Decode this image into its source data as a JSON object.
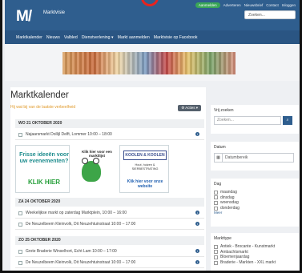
{
  "header": {
    "logo_text": "M/",
    "site_name": "Marktvisie",
    "top_pill": "Aanmelden",
    "top_links": [
      "Adverteren",
      "Nieuwsbrief",
      "Contact",
      "Inloggen"
    ],
    "search_placeholder": "Zoeken..."
  },
  "nav": {
    "items": [
      "Marktkalender",
      "Nieuws",
      "Valbled",
      "Dienstverlening ▾",
      "Markt aanmelden",
      "Marktvisie op Facebook"
    ]
  },
  "main": {
    "title": "Marktkalender",
    "subtitle": "Hij wat bij van de laatste verbeelheid",
    "actions_label": "⚙ Acties ▾",
    "days": [
      {
        "date": "WO 21 OKTOBER 2020",
        "events": [
          "Najaarsmarkt Dollijl Delft, Lommer 10:00 – 18:00"
        ]
      },
      {
        "date": "ZA 24 OKTOBER 2020",
        "events": [
          "Weekelijkse markt op zaterdag Marktplein, 10:00 – 16:00",
          "De Neuzelbeem Kleinvolk, Dit Neuzehtuinstraat 10:00 – 17:00"
        ]
      },
      {
        "date": "ZO 25 OKTOBER 2020",
        "events": [
          "Grote Braderie Winselhort, Echt Lam 10:00 – 17:00",
          "De Neuzelbeem Kleinvolk, Dit Neuzehtuinstraat 10:00 – 17:00"
        ]
      }
    ],
    "ads": {
      "ad1_text": "Frisse ideeën voor uw evenementen?",
      "ad1_cta": "KLIK HIER",
      "ad2_text": "Klik hier voor een marktlijst",
      "ad3_logo": "KOOLEN & KOOLEN",
      "ad3_lines": "Hout, huizen & SIERBESTRATING",
      "ad3_cta": "Klik hier voor onze website"
    }
  },
  "sidebar": {
    "search_title": "Vrij zoeken",
    "search_placeholder": "Zoeken...",
    "date_title": "Datum",
    "date_placeholder": "Datumbereik",
    "day_title": "Dag",
    "days": [
      "maandag",
      "dinsdag",
      "woensdag",
      "donderdag"
    ],
    "more_label": "Meer",
    "type_title": "Markttype",
    "types": [
      "Antiek - Brocante - Kunstmarkt",
      "Ambachtsmarkt",
      "Bloemenjaardag",
      "Braderie - Markten - XXL markt"
    ]
  },
  "colors": {
    "primary": "#2f5e8e",
    "nav": "#2a5583",
    "accent_green": "#3aa657",
    "accent_orange": "#e09a2b"
  }
}
